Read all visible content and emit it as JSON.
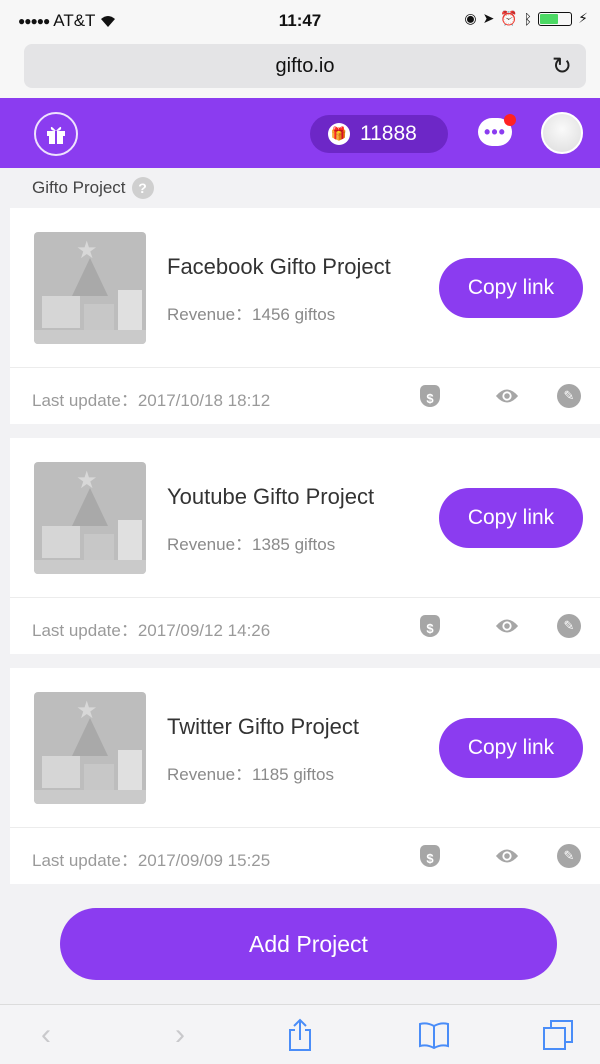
{
  "status_bar": {
    "carrier": "AT&T",
    "time": "11:47"
  },
  "browser": {
    "url": "gifto.io"
  },
  "header": {
    "coin_balance": "11888"
  },
  "breadcrumb": {
    "label": "Gifto Project"
  },
  "projects": [
    {
      "title": "Facebook Gifto Project",
      "revenue": "Revenue：1456 giftos",
      "copy_label": "Copy link",
      "last_update": "Last update：2017/10/18 18:12"
    },
    {
      "title": "Youtube Gifto Project",
      "revenue": "Revenue：1385 giftos",
      "copy_label": "Copy link",
      "last_update": "Last update：2017/09/12 14:26"
    },
    {
      "title": "Twitter Gifto Project",
      "revenue": "Revenue：1185 giftos",
      "copy_label": "Copy link",
      "last_update": "Last update：2017/09/09 15:25"
    }
  ],
  "add_project_label": "Add Project",
  "colors": {
    "accent": "#8b3cf0",
    "accent_dark": "#6d27c7",
    "notification": "#ff2222"
  },
  "icons": [
    "gift-icon",
    "coin-icon",
    "chat-icon",
    "avatar",
    "help-icon",
    "moneybag-icon",
    "eye-icon",
    "pencil-icon",
    "back-icon",
    "forward-icon",
    "share-icon",
    "bookmarks-icon",
    "tabs-icon"
  ]
}
